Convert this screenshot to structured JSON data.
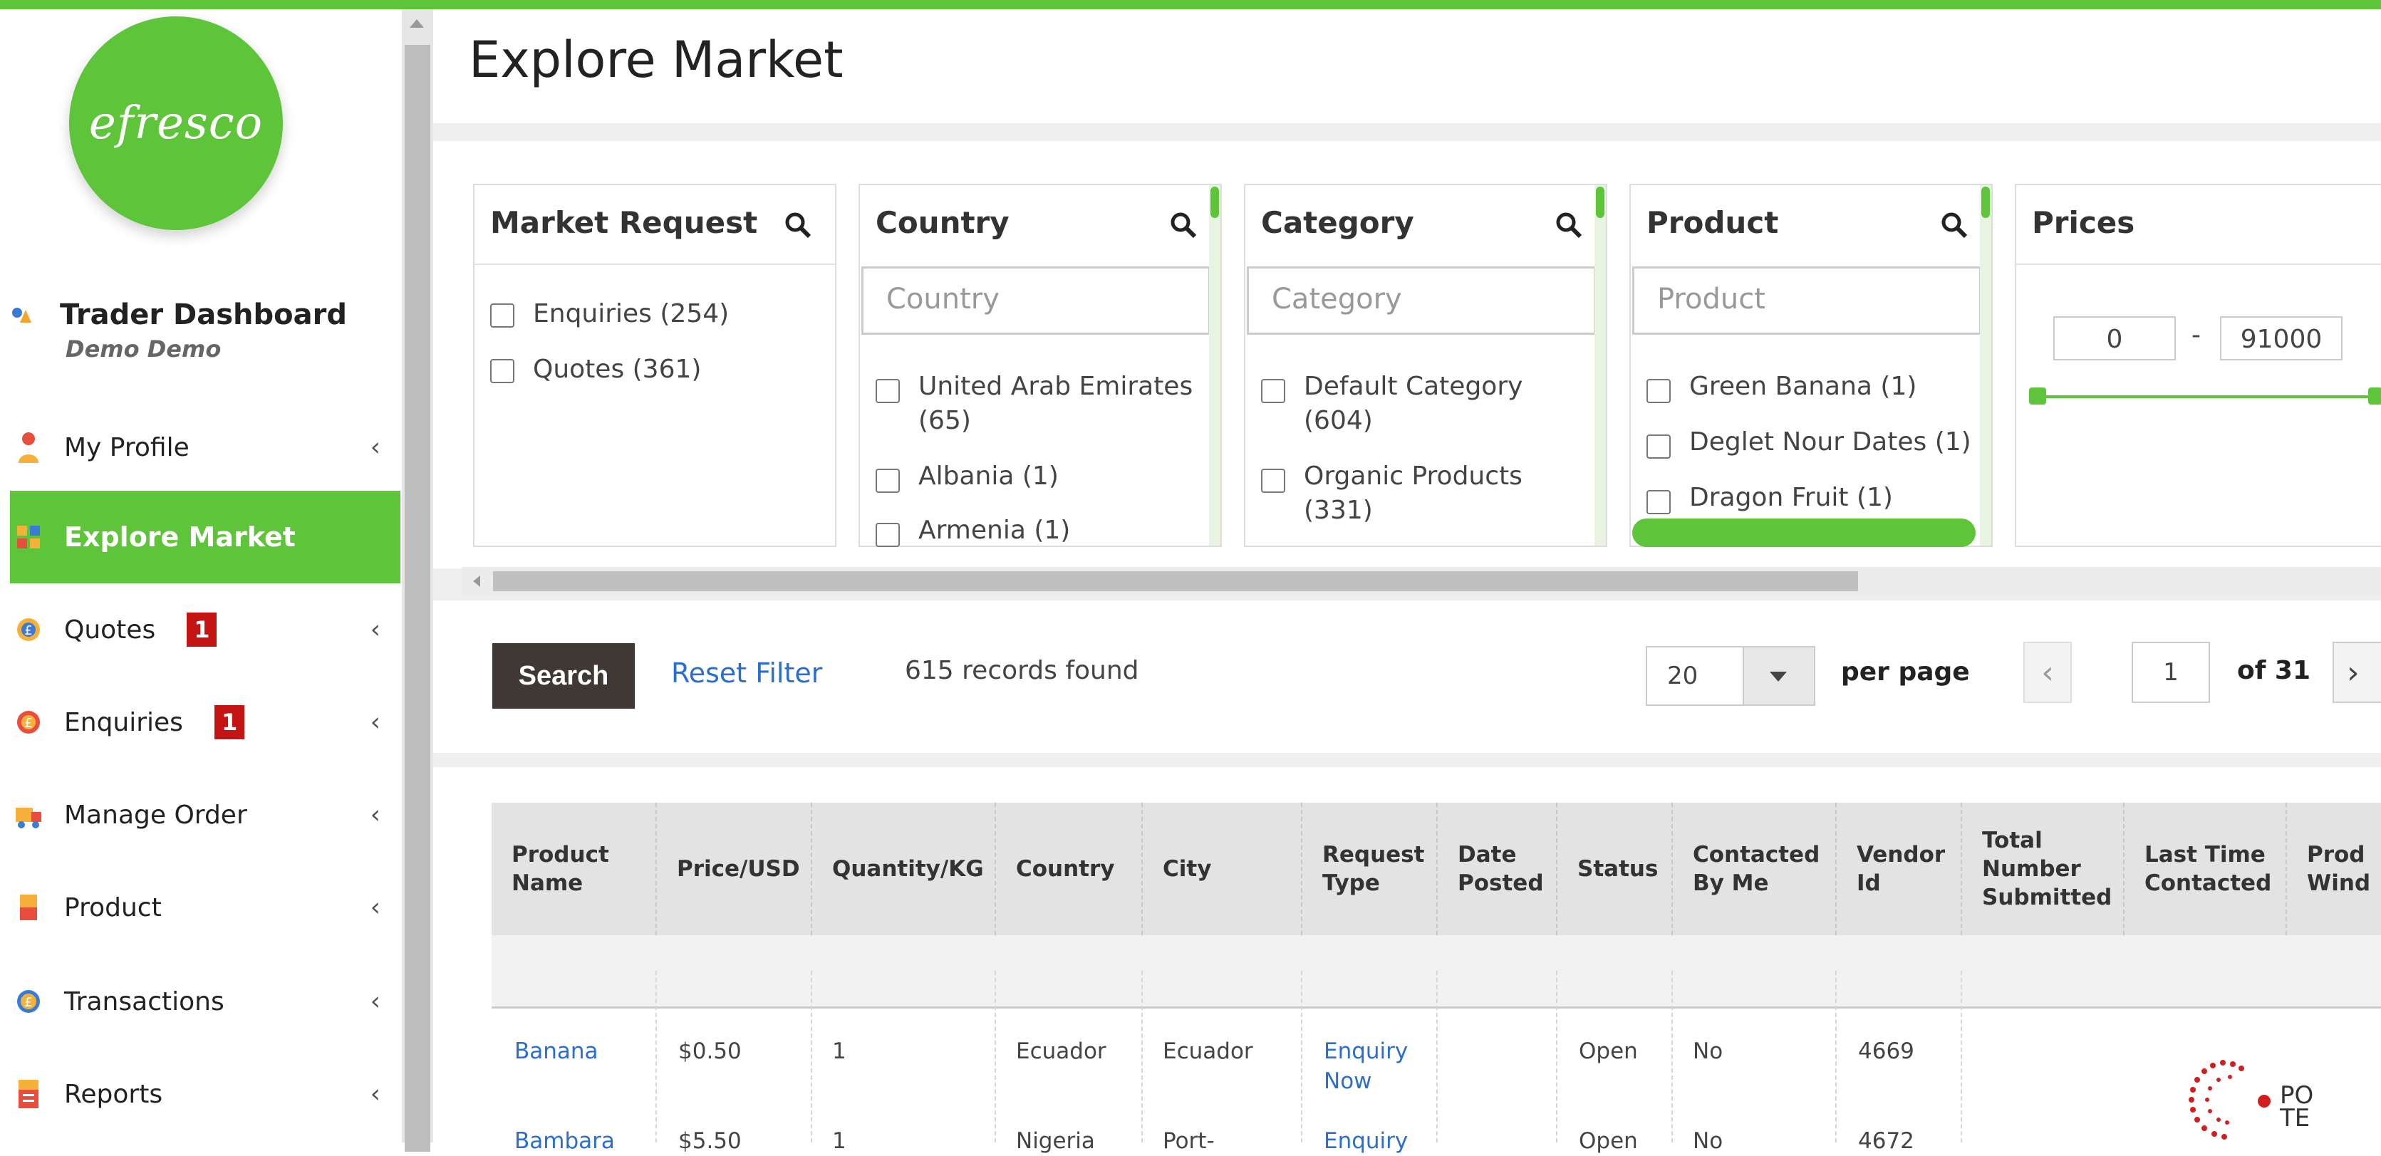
{
  "app": {
    "logo_text": "efresco",
    "accent": "#5ec43a"
  },
  "user": {
    "title": "Trader Dashboard",
    "name": "Demo Demo"
  },
  "menu": {
    "items": [
      {
        "label": "My Profile",
        "icon": "user-icon",
        "badge": ""
      },
      {
        "label": "Explore Market",
        "icon": "market-icon",
        "badge": ""
      },
      {
        "label": "Quotes",
        "icon": "quote-icon",
        "badge": "1"
      },
      {
        "label": "Enquiries",
        "icon": "enquiry-icon",
        "badge": "1"
      },
      {
        "label": "Manage Order",
        "icon": "order-icon",
        "badge": ""
      },
      {
        "label": "Product",
        "icon": "product-icon",
        "badge": ""
      },
      {
        "label": "Transactions",
        "icon": "transactions-icon",
        "badge": ""
      },
      {
        "label": "Reports",
        "icon": "reports-icon",
        "badge": ""
      }
    ],
    "chevron": "‹"
  },
  "page": {
    "title": "Explore Market"
  },
  "filters": {
    "market_request": {
      "title": "Market Request",
      "options": [
        "Enquiries (254)",
        "Quotes (361)"
      ]
    },
    "country": {
      "title": "Country",
      "placeholder": "Country",
      "options": [
        "United Arab Emirates",
        "(65)",
        "Albania (1)",
        "Armenia (1)"
      ]
    },
    "category": {
      "title": "Category",
      "placeholder": "Category",
      "options": [
        "Default Category",
        "(604)",
        "Organic Products",
        "(331)"
      ]
    },
    "product": {
      "title": "Product",
      "placeholder": "Product",
      "options": [
        "Green Banana (1)",
        "Deglet Nour Dates (1)",
        "Dragon Fruit (1)"
      ]
    },
    "prices": {
      "title": "Prices",
      "min": "0",
      "dash": "-",
      "max": "91000"
    }
  },
  "controls": {
    "search": "Search",
    "reset": "Reset Filter",
    "records": "615 records found",
    "per_page_value": "20",
    "per_page_label": "per page",
    "prev": "‹",
    "page": "1",
    "of": "of 31",
    "next": "›"
  },
  "table": {
    "headers": [
      "Product Name",
      "Price/USD",
      "Quantity/KG",
      "Country",
      "City",
      "Request Type",
      "Date Posted",
      "Status",
      "Contacted By Me",
      "Vendor Id",
      "Total Number Submitted",
      "Last Time Contacted",
      "Prod Wind"
    ],
    "rows": [
      {
        "product": "Banana",
        "price": "$0.50",
        "qty": "1",
        "country": "Ecuador",
        "city": "Ecuador",
        "request_type": "Enquiry Now",
        "date": "",
        "status": "Open",
        "contacted": "No",
        "vendor": "4669"
      },
      {
        "product": "Bambara",
        "price": "$5.50",
        "qty": "1",
        "country": "Nigeria",
        "city": "Port-",
        "request_type": "Enquiry",
        "date": "",
        "status": "Open",
        "contacted": "No",
        "vendor": "4672"
      }
    ]
  },
  "footer_brand": {
    "text1": "PO",
    "text2": "TE"
  }
}
